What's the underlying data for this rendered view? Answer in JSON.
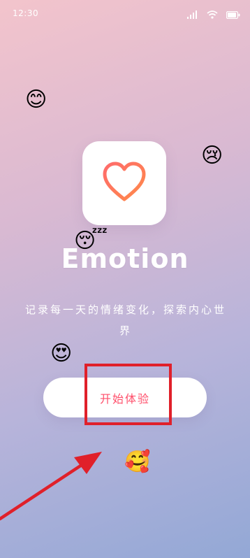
{
  "status_bar": {
    "time": "12:30",
    "icons": [
      "signal-icon",
      "wifi-icon",
      "battery-icon"
    ]
  },
  "app": {
    "icon": "heart-icon",
    "title": "Emotion",
    "tagline": "记录每一天的情绪变化，探索内心世界"
  },
  "start_button": {
    "label": "开始体验"
  },
  "decorative_emojis": [
    {
      "name": "smiling-face-emoji",
      "glyph": "😊"
    },
    {
      "name": "crying-face-emoji",
      "glyph": "😢"
    },
    {
      "name": "sleeping-face-emoji",
      "glyph": "😴"
    },
    {
      "name": "heart-eyes-face-emoji",
      "glyph": "😍"
    },
    {
      "name": "angry-face-emoji",
      "glyph": "😡"
    },
    {
      "name": "smiling-face-with-hearts-emoji",
      "glyph": "🥰"
    }
  ],
  "colors": {
    "accent": "#ff4e6a",
    "annotation_red": "#e0202a",
    "background_top": "#f3c4cc",
    "background_bottom": "#93a8d6"
  }
}
